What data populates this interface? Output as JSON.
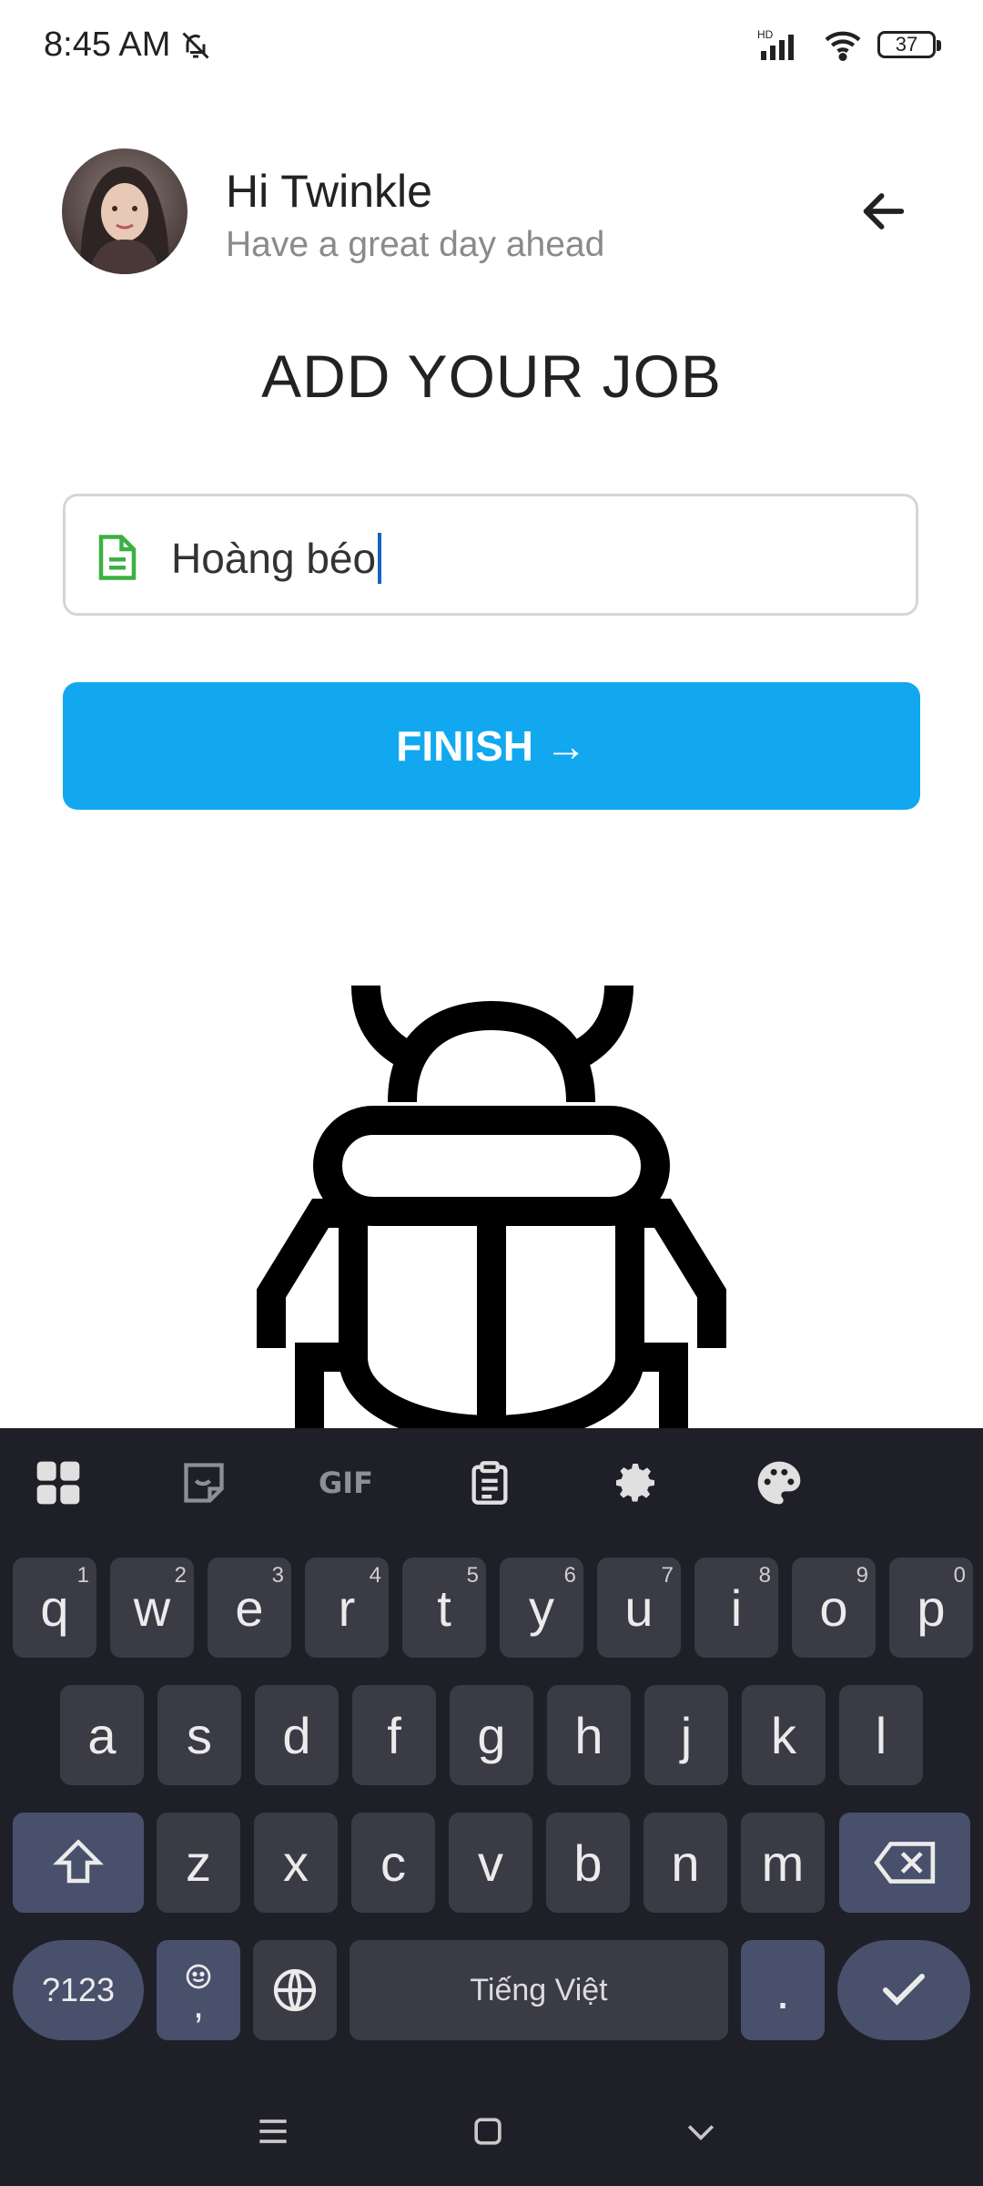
{
  "status": {
    "time": "8:45 AM",
    "battery": "37",
    "network": "HD"
  },
  "header": {
    "greeting": "Hi Twinkle",
    "subtitle": "Have a great day ahead"
  },
  "page": {
    "title": "ADD YOUR JOB"
  },
  "job_input": {
    "value": "Hoàng béo"
  },
  "finish_button": {
    "label": "FINISH →"
  },
  "keyboard": {
    "row1": [
      {
        "k": "q",
        "n": "1"
      },
      {
        "k": "w",
        "n": "2"
      },
      {
        "k": "e",
        "n": "3"
      },
      {
        "k": "r",
        "n": "4"
      },
      {
        "k": "t",
        "n": "5"
      },
      {
        "k": "y",
        "n": "6"
      },
      {
        "k": "u",
        "n": "7"
      },
      {
        "k": "i",
        "n": "8"
      },
      {
        "k": "o",
        "n": "9"
      },
      {
        "k": "p",
        "n": "0"
      }
    ],
    "row2": [
      "a",
      "s",
      "d",
      "f",
      "g",
      "h",
      "j",
      "k",
      "l"
    ],
    "row3": [
      "z",
      "x",
      "c",
      "v",
      "b",
      "n",
      "m"
    ],
    "symbols_label": "?123",
    "comma_label": ",",
    "space_label": "Tiếng Việt",
    "period_label": ".",
    "toolbar_gif_label": "GIF"
  },
  "colors": {
    "accent": "#12a8ef",
    "doc_icon": "#3cb043",
    "keyboard_bg": "#1f1f28"
  }
}
